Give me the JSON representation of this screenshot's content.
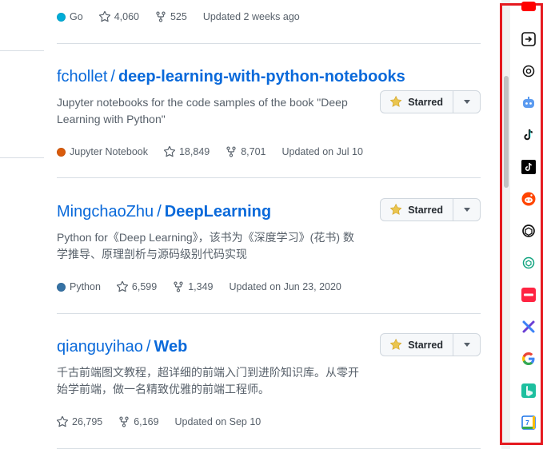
{
  "top_repo": {
    "language": "Go",
    "language_color": "#00add8",
    "stars": "4,060",
    "forks": "525",
    "updated": "Updated 2 weeks ago"
  },
  "repos": [
    {
      "owner": "fchollet",
      "name": "deep-learning-with-python-notebooks",
      "description": "Jupyter notebooks for the code samples of the book \"Deep Learning with Python\"",
      "star_label": "Starred",
      "language": "Jupyter Notebook",
      "language_color": "#da5b0b",
      "stars": "18,849",
      "forks": "8,701",
      "updated": "Updated on Jul 10"
    },
    {
      "owner": "MingchaoZhu",
      "name": "DeepLearning",
      "description": "Python for《Deep Learning》，该书为《深度学习》(花书) 数学推导、原理剖析与源码级别代码实现",
      "star_label": "Starred",
      "language": "Python",
      "language_color": "#3572a5",
      "stars": "6,599",
      "forks": "1,349",
      "updated": "Updated on Jun 23, 2020"
    },
    {
      "owner": "qianguyihao",
      "name": "Web",
      "description": "千古前端图文教程，超详细的前端入门到进阶知识库。从零开始学前端，做一名精致优雅的前端工程师。",
      "star_label": "Starred",
      "language": "",
      "language_color": "",
      "stars": "26,795",
      "forks": "6,169",
      "updated": "Updated on Sep 10"
    }
  ],
  "sidebar_icons": [
    {
      "name": "youtube-icon",
      "color": "#ff0000"
    },
    {
      "name": "readwise-icon",
      "color": "#111111"
    },
    {
      "name": "openai-icon",
      "color": "#111111"
    },
    {
      "name": "robot-icon",
      "color": "#5b9bf0"
    },
    {
      "name": "tiktok-icon",
      "color": "#111111"
    },
    {
      "name": "tiktok-dark-icon",
      "color": "#000000"
    },
    {
      "name": "reddit-icon",
      "color": "#ff4500"
    },
    {
      "name": "chatgpt-icon",
      "color": "#111111"
    },
    {
      "name": "chatgpt-teal-icon",
      "color": "#10a37f"
    },
    {
      "name": "xiaohongshu-icon",
      "color": "#ff2442",
      "text": "小红书"
    },
    {
      "name": "perplexity-icon",
      "color": "#6b3fd4"
    },
    {
      "name": "google-icon",
      "color": "#4285f4",
      "text": "G"
    },
    {
      "name": "bing-icon",
      "color": "#1dbf9f",
      "text": "B"
    },
    {
      "name": "calendar-icon",
      "color": "#1a73e8",
      "text": "7"
    }
  ]
}
